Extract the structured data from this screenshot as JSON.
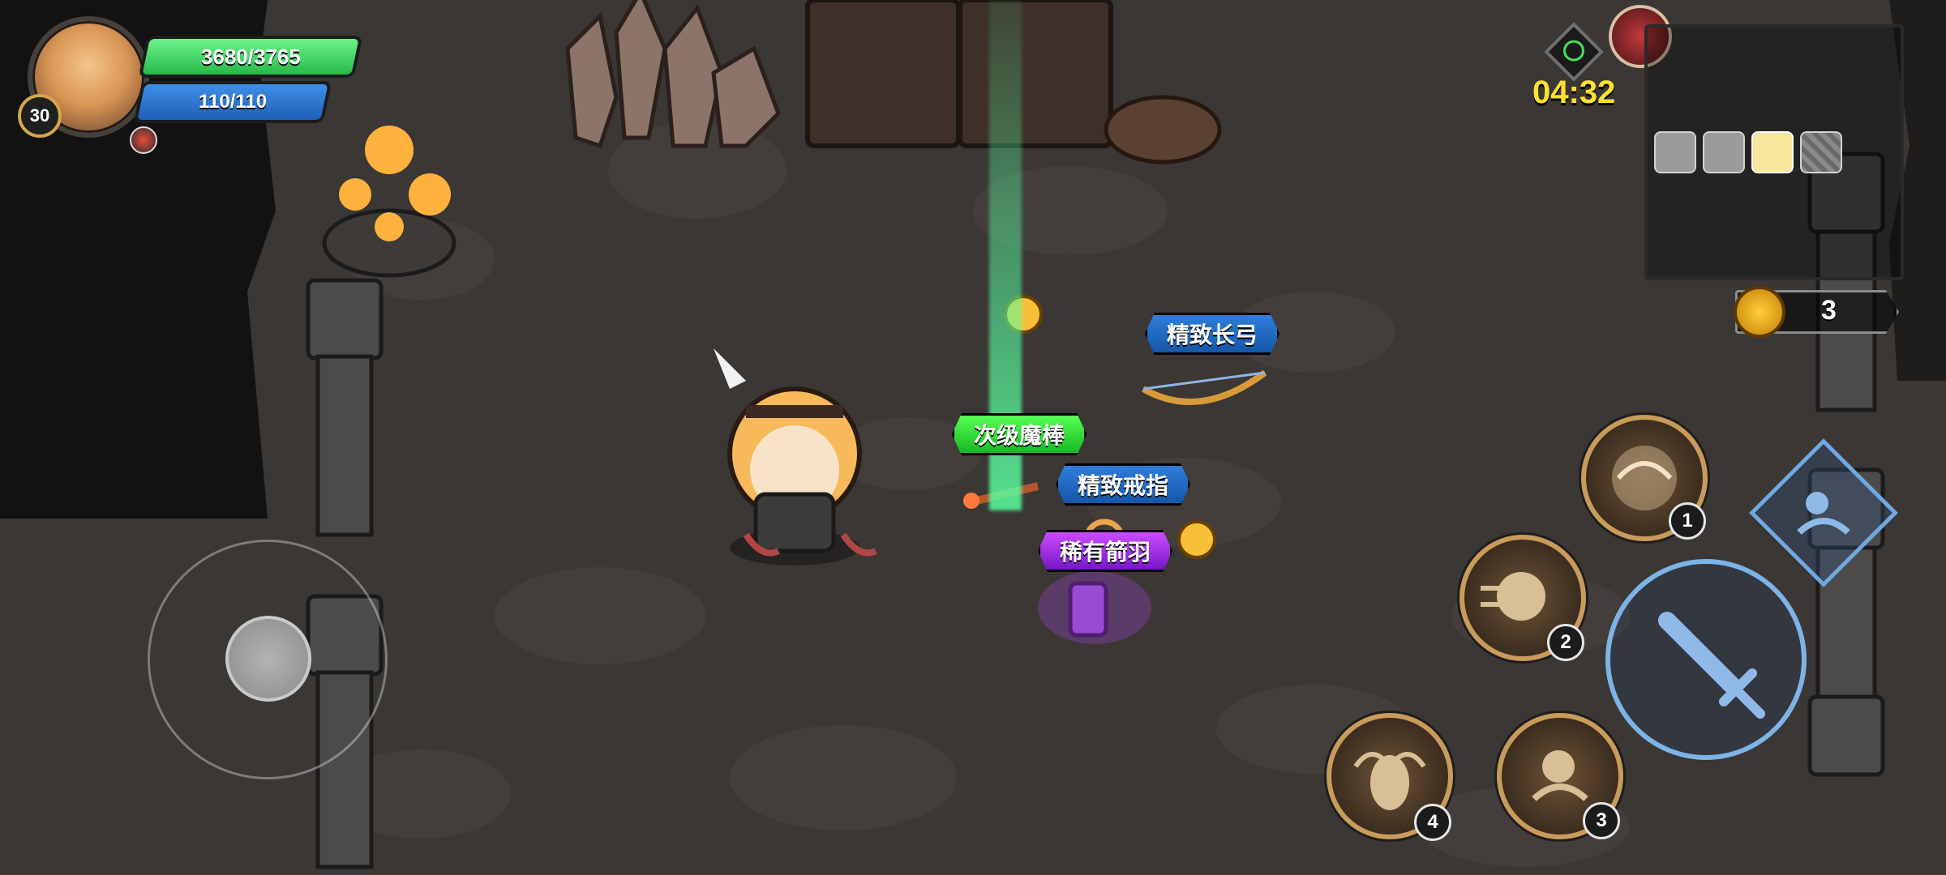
{
  "player": {
    "hp_text": "3680/3765",
    "mp_text": "110/110",
    "level": "30",
    "hp_color": "#33c457",
    "mp_color": "#2a6fd0"
  },
  "hud": {
    "timer": "04:32",
    "coins": "3",
    "timer_color": "#ffe230"
  },
  "minimap": {
    "slots": [
      "empty",
      "empty",
      "active-chest",
      "hatched"
    ]
  },
  "drops": [
    {
      "name": "精致长弓",
      "rarity": "blue"
    },
    {
      "name": "次级魔棒",
      "rarity": "green"
    },
    {
      "name": "精致戒指",
      "rarity": "blue"
    },
    {
      "name": "稀有箭羽",
      "rarity": "purple"
    }
  ],
  "skills": [
    {
      "badge": "1",
      "icon": "crossbow-skill-icon"
    },
    {
      "badge": "2",
      "icon": "dash-skill-icon"
    },
    {
      "badge": "3",
      "icon": "roll-skill-icon"
    },
    {
      "badge": "4",
      "icon": "angel-skill-icon"
    }
  ],
  "controls": {
    "attack_icon": "sword-icon",
    "dodge_icon": "dodge-icon",
    "joystick_icon": "joystick-icon"
  }
}
